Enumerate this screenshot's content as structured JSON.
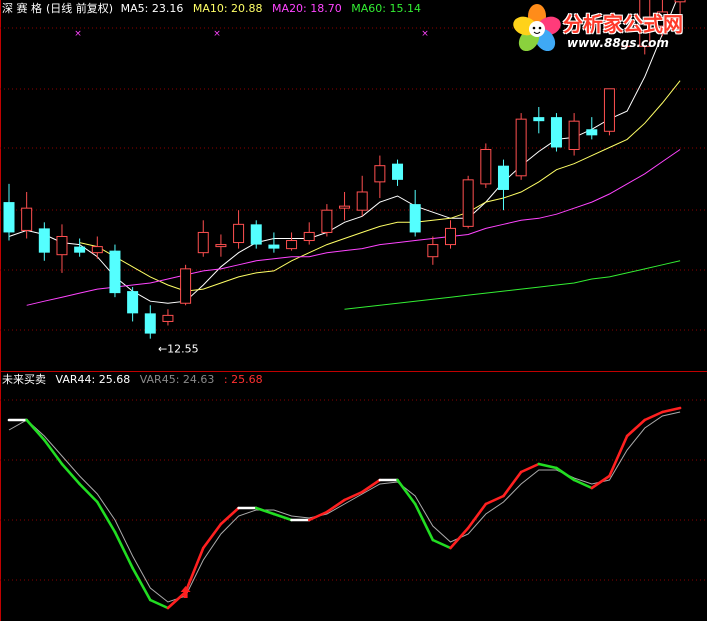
{
  "top_header": {
    "stock_name": "深 赛 格",
    "period_note": "(日线 前复权)",
    "ma5": {
      "label": "MA5:",
      "value": "23.16",
      "color": "#ffffff"
    },
    "ma10": {
      "label": "MA10:",
      "value": "20.88",
      "color": "#ffff66"
    },
    "ma20": {
      "label": "MA20:",
      "value": "18.70",
      "color": "#ff44ff"
    },
    "ma60": {
      "label": "MA60:",
      "value": "15.14",
      "color": "#33ee33"
    }
  },
  "bottom_header": {
    "indicator_name": "未来买卖",
    "var44": {
      "label": "VAR44:",
      "value": "25.68"
    },
    "var45": {
      "label": "VAR45:",
      "value": "24.63"
    },
    "third_value": ": 25.68"
  },
  "logo": {
    "title": "分析家公式网",
    "url": "www.88gs.com"
  },
  "colors": {
    "up": "#ff5050",
    "down": "#54ffff",
    "grid": "#8b0000",
    "ma5": "#ffffff",
    "ma10": "#ffff66",
    "ma20": "#ff44ff",
    "ma60": "#33ee33",
    "rise": "#ff2020",
    "fall": "#22dd22",
    "flat": "#ffffff",
    "signal": "#aaaaaa"
  },
  "chart_data": [
    {
      "type": "candlestick",
      "title": "深 赛 格",
      "ylim": [
        11.0,
        28.4
      ],
      "low_marker": {
        "index": 9,
        "value": 12.55,
        "text": "12.55"
      },
      "candles": [
        {
          "o": 19.3,
          "c": 17.8,
          "h": 20.2,
          "l": 17.4
        },
        {
          "o": 17.9,
          "c": 19.0,
          "h": 19.8,
          "l": 17.5
        },
        {
          "o": 18.0,
          "c": 16.8,
          "h": 18.3,
          "l": 16.4
        },
        {
          "o": 16.7,
          "c": 17.6,
          "h": 18.2,
          "l": 15.8
        },
        {
          "o": 17.1,
          "c": 16.8,
          "h": 17.5,
          "l": 16.6
        },
        {
          "o": 16.8,
          "c": 17.1,
          "h": 17.6,
          "l": 16.5
        },
        {
          "o": 16.9,
          "c": 14.8,
          "h": 17.2,
          "l": 14.6
        },
        {
          "o": 14.9,
          "c": 13.8,
          "h": 15.1,
          "l": 13.4
        },
        {
          "o": 13.8,
          "c": 12.8,
          "h": 14.2,
          "l": 12.55
        },
        {
          "o": 13.4,
          "c": 13.7,
          "h": 14.0,
          "l": 13.2
        },
        {
          "o": 14.3,
          "c": 16.0,
          "h": 16.2,
          "l": 14.2
        },
        {
          "o": 16.8,
          "c": 17.8,
          "h": 18.4,
          "l": 16.6
        },
        {
          "o": 17.1,
          "c": 17.2,
          "h": 17.7,
          "l": 16.6
        },
        {
          "o": 17.3,
          "c": 18.2,
          "h": 18.9,
          "l": 17.0
        },
        {
          "o": 18.2,
          "c": 17.2,
          "h": 18.4,
          "l": 17.0
        },
        {
          "o": 17.2,
          "c": 17.0,
          "h": 17.8,
          "l": 16.8
        },
        {
          "o": 17.0,
          "c": 17.4,
          "h": 17.8,
          "l": 16.9
        },
        {
          "o": 17.4,
          "c": 17.8,
          "h": 18.3,
          "l": 17.2
        },
        {
          "o": 17.8,
          "c": 18.9,
          "h": 19.2,
          "l": 17.6
        },
        {
          "o": 19.0,
          "c": 19.1,
          "h": 19.8,
          "l": 18.4
        },
        {
          "o": 18.9,
          "c": 19.8,
          "h": 20.6,
          "l": 18.6
        },
        {
          "o": 20.3,
          "c": 21.1,
          "h": 21.6,
          "l": 19.5
        },
        {
          "o": 21.2,
          "c": 20.4,
          "h": 21.4,
          "l": 20.1
        },
        {
          "o": 19.2,
          "c": 17.8,
          "h": 19.9,
          "l": 17.6
        },
        {
          "o": 16.6,
          "c": 17.2,
          "h": 17.6,
          "l": 16.2
        },
        {
          "o": 17.2,
          "c": 18.0,
          "h": 18.4,
          "l": 17.0
        },
        {
          "o": 18.1,
          "c": 20.4,
          "h": 20.6,
          "l": 18.0
        },
        {
          "o": 20.2,
          "c": 21.9,
          "h": 22.2,
          "l": 20.0
        },
        {
          "o": 21.1,
          "c": 19.9,
          "h": 21.4,
          "l": 18.9
        },
        {
          "o": 20.6,
          "c": 23.4,
          "h": 23.7,
          "l": 20.4
        },
        {
          "o": 23.5,
          "c": 23.3,
          "h": 24.0,
          "l": 22.7
        },
        {
          "o": 23.5,
          "c": 22.0,
          "h": 23.7,
          "l": 21.8
        },
        {
          "o": 21.9,
          "c": 23.3,
          "h": 23.7,
          "l": 21.6
        },
        {
          "o": 22.9,
          "c": 22.6,
          "h": 23.5,
          "l": 22.4
        },
        {
          "o": 22.8,
          "c": 24.9,
          "h": 24.9,
          "l": 22.6
        },
        {
          "o": 27.0,
          "c": 27.0,
          "h": 27.0,
          "l": 27.0
        },
        {
          "o": 27.0,
          "c": 30.6,
          "h": 30.6,
          "l": 26.6
        },
        {
          "o": 28.0,
          "c": 28.7,
          "h": 30.1,
          "l": 27.5
        },
        {
          "o": 29.2,
          "c": 31.5,
          "h": 31.5,
          "l": 28.6
        }
      ],
      "series": [
        {
          "name": "MA5",
          "values": [
            17.6,
            17.9,
            17.7,
            17.3,
            17.2,
            16.6,
            15.6,
            14.9,
            14.4,
            14.3,
            14.4,
            15.2,
            16.1,
            16.8,
            17.3,
            17.5,
            17.5,
            17.5,
            17.8,
            18.3,
            18.6,
            19.3,
            19.6,
            19.1,
            18.8,
            18.5,
            18.5,
            19.3,
            20.3,
            21.1,
            21.8,
            22.4,
            22.5,
            22.9,
            23.4,
            23.8,
            25.5,
            27.6,
            29.7
          ]
        },
        {
          "name": "MA10",
          "values": [
            null,
            null,
            null,
            null,
            17.3,
            17.1,
            16.6,
            16.1,
            15.6,
            15.2,
            14.9,
            15.0,
            15.3,
            15.6,
            15.8,
            15.9,
            16.4,
            16.8,
            17.2,
            17.5,
            17.8,
            18.1,
            18.3,
            18.3,
            18.4,
            18.5,
            18.8,
            19.3,
            19.5,
            19.8,
            20.3,
            20.9,
            21.2,
            21.6,
            22.0,
            22.4,
            23.2,
            24.2,
            25.3
          ]
        },
        {
          "name": "MA20",
          "values": [
            null,
            14.2,
            14.4,
            14.6,
            14.8,
            15.0,
            15.1,
            15.2,
            15.3,
            15.5,
            15.7,
            15.9,
            16.0,
            16.2,
            16.4,
            16.5,
            16.6,
            16.6,
            16.8,
            16.9,
            17.0,
            17.2,
            17.3,
            17.4,
            17.5,
            17.6,
            17.7,
            18.0,
            18.2,
            18.4,
            18.5,
            18.7,
            19.0,
            19.3,
            19.7,
            20.2,
            20.7,
            21.3,
            21.9
          ]
        },
        {
          "name": "MA60",
          "values": [
            null,
            null,
            null,
            null,
            null,
            null,
            null,
            null,
            null,
            null,
            null,
            null,
            null,
            null,
            null,
            null,
            null,
            null,
            null,
            14.0,
            14.1,
            14.2,
            14.3,
            14.4,
            14.5,
            14.6,
            14.7,
            14.8,
            14.9,
            15.0,
            15.1,
            15.2,
            15.3,
            15.5,
            15.6,
            15.8,
            16.0,
            16.2,
            16.4
          ]
        }
      ]
    },
    {
      "type": "line",
      "title": "未来买卖",
      "ylim": [
        0,
        100
      ],
      "x": [
        0,
        1,
        2,
        3,
        4,
        5,
        6,
        7,
        8,
        9,
        10,
        11,
        12,
        13,
        14,
        15,
        16,
        17,
        18,
        19,
        20,
        21,
        22,
        23,
        24,
        25,
        26,
        27,
        28,
        29,
        30,
        31,
        32,
        33,
        34,
        35,
        36,
        37,
        38,
        39
      ],
      "series": [
        {
          "name": "VAR44",
          "values": [
            94,
            94,
            84,
            72,
            62,
            53,
            38,
            20,
            4,
            0,
            8,
            30,
            42,
            50,
            50,
            47,
            44,
            44,
            48,
            54,
            58,
            64,
            64,
            52,
            34,
            30,
            40,
            52,
            56,
            68,
            72,
            70,
            64,
            60,
            66,
            86,
            94,
            98,
            100
          ]
        },
        {
          "name": "VAR45",
          "values": [
            89,
            94,
            86,
            76,
            66,
            57,
            44,
            26,
            10,
            3,
            6,
            24,
            37,
            46,
            49,
            49,
            46,
            45,
            47,
            52,
            57,
            62,
            63,
            56,
            41,
            33,
            37,
            47,
            53,
            62,
            69,
            69,
            65,
            62,
            64,
            79,
            90,
            96,
            98
          ]
        }
      ]
    }
  ]
}
